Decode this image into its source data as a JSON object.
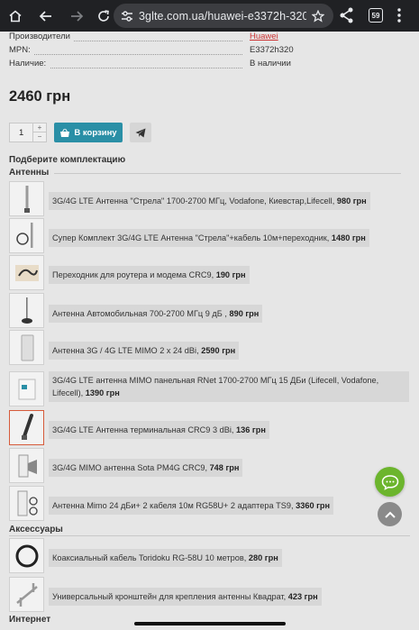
{
  "browser": {
    "url": "3glte.com.ua/huawei-e3372h-320-",
    "tab_count": "59",
    "icons": [
      "home-icon",
      "back-icon",
      "forward-icon",
      "reload-icon",
      "site-settings-icon",
      "star-icon",
      "share-icon",
      "tabs-icon",
      "menu-icon"
    ]
  },
  "specs": [
    {
      "label": "Производители",
      "value": "Huawei",
      "link": true
    },
    {
      "label": "MPN:",
      "value": "E3372h320",
      "link": false
    },
    {
      "label": "Наличие:",
      "value": "В наличии",
      "link": false
    }
  ],
  "product": {
    "price": "2460 грн",
    "quantity": "1",
    "cart_label": "В корзину"
  },
  "bundle_title": "Подберите комплектацию",
  "categories": {
    "antennas": "Антенны",
    "accessories": "Аксессуары",
    "internet": "Интернет"
  },
  "antennas": [
    {
      "name": "3G/4G LTE Антенна \"Стрела\" 1700-2700 МГц, Vodafone, Киевстар,Lifecell,",
      "price": "980 грн"
    },
    {
      "name": "Супер Комплект 3G/4G LTE Антенна \"Стрела\"+кабель 10м+переходник,",
      "price": "1480 грн"
    },
    {
      "name": "Переходник для роутера и модема CRC9,",
      "price": "190 грн"
    },
    {
      "name": "Антенна Автомобильная 700-2700 МГц 9 дБ ,",
      "price": "890 грн"
    },
    {
      "name": "Антенна 3G / 4G LTE MIMO 2 x 24 dBi,",
      "price": "2590 грн"
    },
    {
      "name": "3G/4G LTE антенна MIMO панельная RNet 1700-2700 МГц 15 ДБи (Lifecell, Vodafone, Lifecell),",
      "price": "1390 грн"
    },
    {
      "name": "3G/4G LTE Антенна терминальная CRC9 3 dBi,",
      "price": "136 грн"
    },
    {
      "name": "3G/4G MIMO антенна Sota PM4G CRC9,",
      "price": "748 грн"
    },
    {
      "name": "Антенна Mimo 24 дБи+ 2 кабеля 10м RG58U+ 2 адаптера TS9,",
      "price": "3360 грн"
    }
  ],
  "accessories": [
    {
      "name": "Коаксиальный кабель Toridoku RG-58U 10 метров,",
      "price": "280 грн"
    },
    {
      "name": "Универсальный кронштейн для крепления антенны Квадрат,",
      "price": "423 грн"
    }
  ],
  "colors": {
    "accent": "#2a8fa6",
    "link": "#cc3333",
    "chat": "#6cb52d"
  }
}
